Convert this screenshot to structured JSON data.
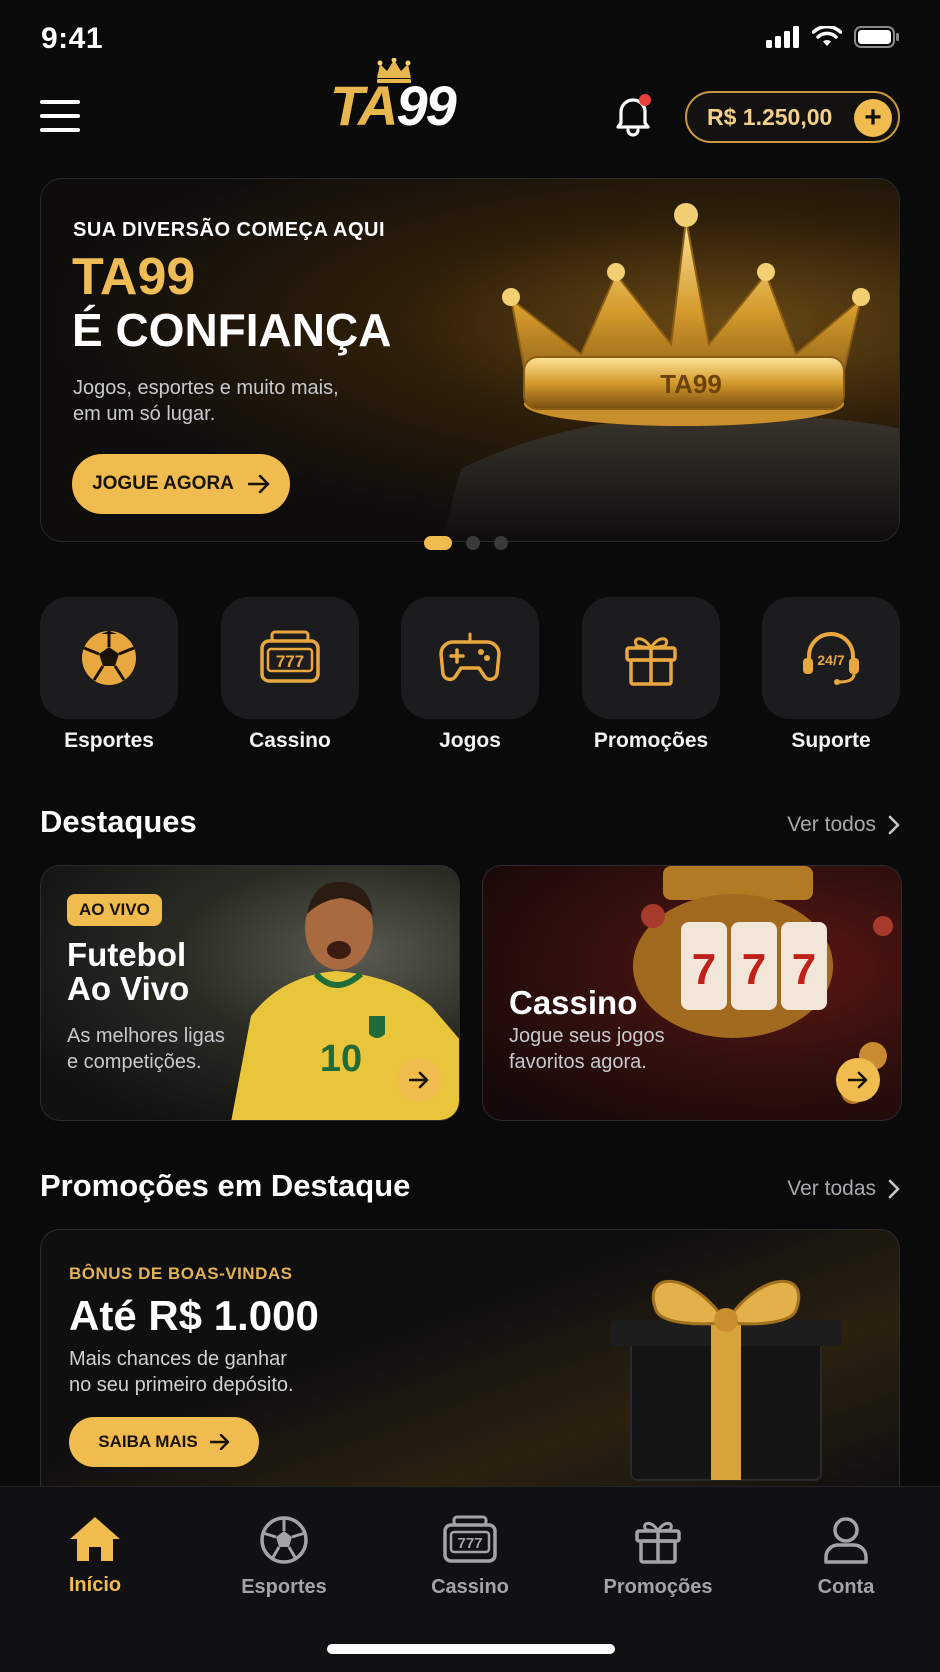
{
  "status_bar": {
    "time": "9:41"
  },
  "header": {
    "logo": "TA99",
    "balance": "R$ 1.250,00",
    "balance_add_label": "+"
  },
  "hero": {
    "kicker": "SUA DIVERSÃO COMEÇA AQUI",
    "brand": "TA99",
    "title": "É CONFIANÇA",
    "subtitle_line1": "Jogos, esportes e muito mais,",
    "subtitle_line2": "em um só lugar.",
    "cta_label": "JOGUE AGORA",
    "crown_text": "TA99",
    "slides": 3,
    "active_slide": 1
  },
  "quick_categories": [
    {
      "label": "Esportes",
      "icon": "soccer-ball-icon"
    },
    {
      "label": "Cassino",
      "icon": "slot-machine-icon"
    },
    {
      "label": "Jogos",
      "icon": "gamepad-icon"
    },
    {
      "label": "Promoções",
      "icon": "gift-icon"
    },
    {
      "label": "Suporte",
      "icon": "headset-icon",
      "icon_text": "24/7"
    }
  ],
  "highlights": {
    "title": "Destaques",
    "see_all": "Ver todos",
    "cards": [
      {
        "badge": "AO VIVO",
        "title_line1": "Futebol",
        "title_line2": "Ao Vivo",
        "sub_line1": "As melhores ligas",
        "sub_line2": "e competições.",
        "jersey_number": "10"
      },
      {
        "title_line1": "Cassino",
        "sub_line1": "Jogue seus jogos",
        "sub_line2": "favoritos agora.",
        "reels": [
          "7",
          "7",
          "7"
        ]
      }
    ]
  },
  "promotions": {
    "title": "Promoções em Destaque",
    "see_all": "Ver todas",
    "promo": {
      "kicker": "BÔNUS DE BOAS-VINDAS",
      "title": "Até R$ 1.000",
      "sub_line1": "Mais chances de ganhar",
      "sub_line2": "no seu primeiro depósito.",
      "cta_label": "SAIBA MAIS"
    }
  },
  "bottom_nav": [
    {
      "label": "Início",
      "icon": "home-icon",
      "active": true
    },
    {
      "label": "Esportes",
      "icon": "soccer-ball-icon",
      "active": false
    },
    {
      "label": "Cassino",
      "icon": "slot-machine-icon",
      "active": false
    },
    {
      "label": "Promoções",
      "icon": "gift-icon",
      "active": false
    },
    {
      "label": "Conta",
      "icon": "user-icon",
      "active": false
    }
  ],
  "colors": {
    "accent": "#f0bb4f",
    "background": "#0a0a0b",
    "tile": "#1c1c1f",
    "notification": "#e8403a"
  }
}
